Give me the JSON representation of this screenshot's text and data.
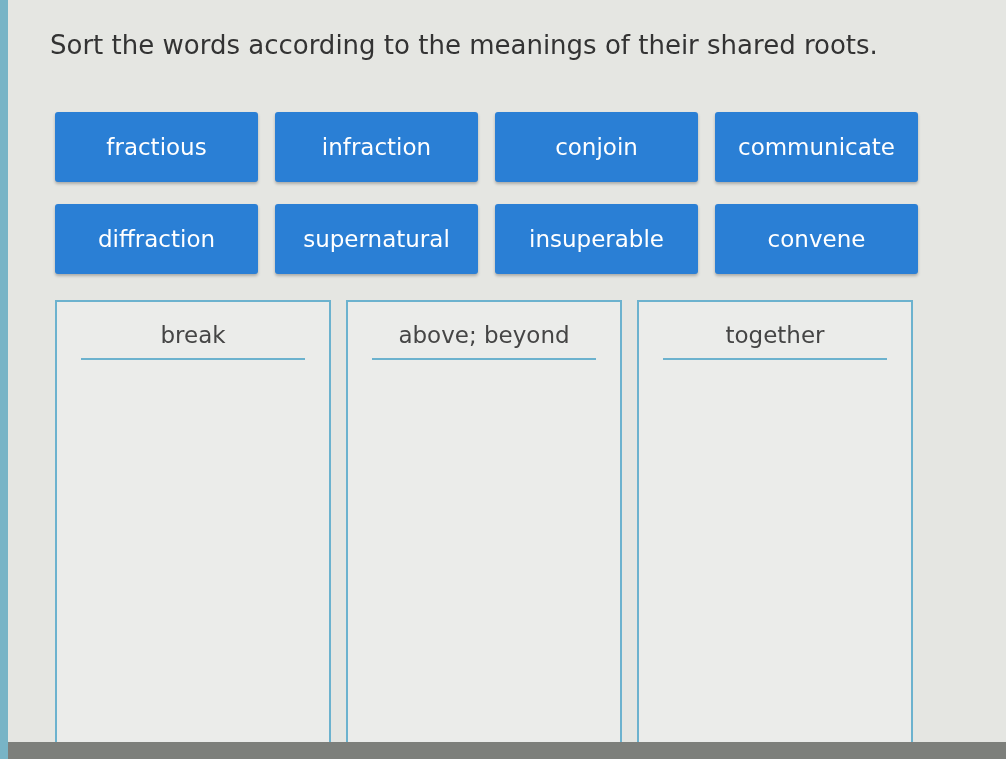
{
  "prompt": "Sort the words according to the meanings of their shared roots.",
  "word_tiles": [
    {
      "label": "fractious"
    },
    {
      "label": "infraction"
    },
    {
      "label": "conjoin"
    },
    {
      "label": "communicate"
    },
    {
      "label": "diffraction"
    },
    {
      "label": "supernatural"
    },
    {
      "label": "insuperable"
    },
    {
      "label": "convene"
    }
  ],
  "categories": [
    {
      "label": "break"
    },
    {
      "label": "above; beyond"
    },
    {
      "label": "together"
    }
  ]
}
